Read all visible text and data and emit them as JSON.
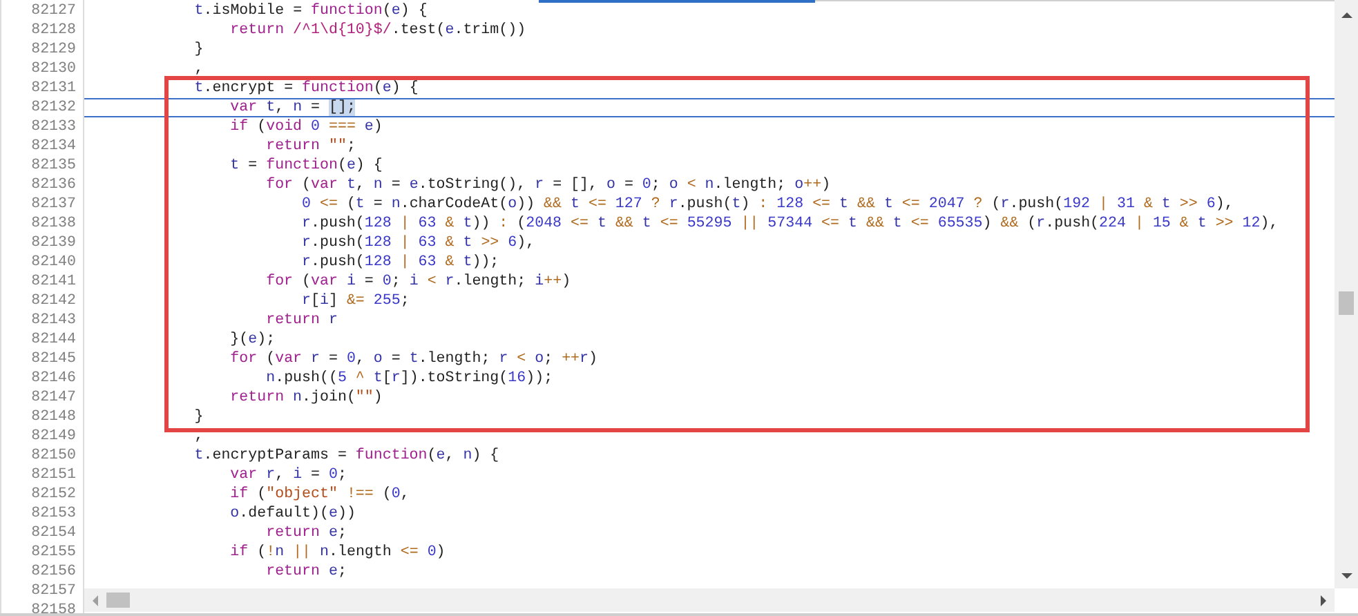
{
  "editor": {
    "sections": [
      {
        "kind": "plain",
        "lines": [
          {
            "number": "82127",
            "code": "            t.isMobile = function(e) {",
            "current": false
          },
          {
            "number": "82128",
            "code": "                return /^1\\d{10}$/.test(e.trim())",
            "current": false
          },
          {
            "number": "82129",
            "code": "            }",
            "current": false
          },
          {
            "number": "82130",
            "code": "            ,",
            "current": false
          }
        ]
      },
      {
        "kind": "boxed",
        "lines": [
          {
            "number": "82131",
            "code": "            t.encrypt = function(e) {",
            "current": false
          },
          {
            "number": "82132",
            "code": "                var t, n = ",
            "selected": "[];",
            "current": true
          },
          {
            "number": "82133",
            "code": "                if (void 0 === e)",
            "current": false
          },
          {
            "number": "82134",
            "code": "                    return \"\";",
            "current": false
          },
          {
            "number": "82135",
            "code": "                t = function(e) {",
            "current": false
          },
          {
            "number": "82136",
            "code": "                    for (var t, n = e.toString(), r = [], o = 0; o < n.length; o++)",
            "current": false
          },
          {
            "number": "82137",
            "code": "                        0 <= (t = n.charCodeAt(o)) && t <= 127 ? r.push(t) : 128 <= t && t <= 2047 ? (r.push(192 | 31 & t >> 6),",
            "current": false
          },
          {
            "number": "82138",
            "code": "                        r.push(128 | 63 & t)) : (2048 <= t && t <= 55295 || 57344 <= t && t <= 65535) && (r.push(224 | 15 & t >> 12),",
            "current": false
          },
          {
            "number": "82139",
            "code": "                        r.push(128 | 63 & t >> 6),",
            "current": false
          },
          {
            "number": "82140",
            "code": "                        r.push(128 | 63 & t));",
            "current": false
          },
          {
            "number": "82141",
            "code": "                    for (var i = 0; i < r.length; i++)",
            "current": false
          },
          {
            "number": "82142",
            "code": "                        r[i] &= 255;",
            "current": false
          },
          {
            "number": "82143",
            "code": "                    return r",
            "current": false
          },
          {
            "number": "82144",
            "code": "                }(e);",
            "current": false
          },
          {
            "number": "82145",
            "code": "                for (var r = 0, o = t.length; r < o; ++r)",
            "current": false
          },
          {
            "number": "82146",
            "code": "                    n.push((5 ^ t[r]).toString(16));",
            "current": false
          },
          {
            "number": "82147",
            "code": "                return n.join(\"\")",
            "current": false
          },
          {
            "number": "82148",
            "code": "            }",
            "current": false
          }
        ]
      },
      {
        "kind": "plain",
        "lines": [
          {
            "number": "82149",
            "code": "            ,",
            "current": false
          },
          {
            "number": "82150",
            "code": "            t.encryptParams = function(e, n) {",
            "current": false
          },
          {
            "number": "82151",
            "code": "                var r, i = 0;",
            "current": false
          },
          {
            "number": "82152",
            "code": "                if (\"object\" !== (0,",
            "current": false
          },
          {
            "number": "82153",
            "code": "                o.default)(e))",
            "current": false
          },
          {
            "number": "82154",
            "code": "                    return e;",
            "current": false
          },
          {
            "number": "82155",
            "code": "                if (!n || n.length <= 0)",
            "current": false
          },
          {
            "number": "82156",
            "code": "                    return e;",
            "current": false
          },
          {
            "number": "82157",
            "current": false
          },
          {
            "number": "82158"
          }
        ]
      }
    ]
  }
}
